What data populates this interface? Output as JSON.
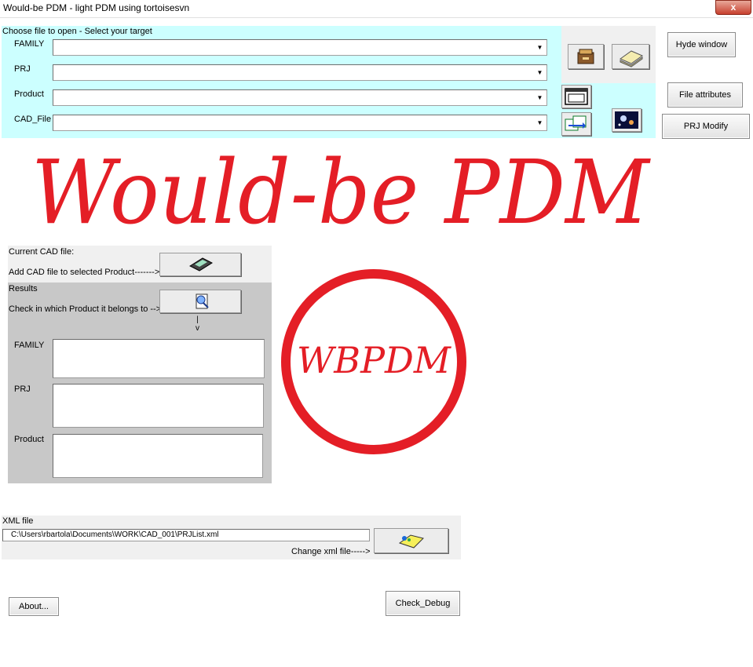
{
  "window": {
    "title": "Would-be PDM - light PDM using tortoisesvn",
    "close_label": "x"
  },
  "target": {
    "header": "Choose file to open - Select your target",
    "fields": [
      {
        "label": "FAMILY",
        "value": ""
      },
      {
        "label": "PRJ",
        "value": ""
      },
      {
        "label": "Product",
        "value": ""
      },
      {
        "label": "CAD_File",
        "value": ""
      }
    ]
  },
  "right_buttons": {
    "hide": "Hyde window",
    "attributes": "File attributes",
    "prj_modify": "PRJ Modify"
  },
  "logo": {
    "banner": "Would-be PDM",
    "seal": "WBPDM"
  },
  "cad_panel": {
    "current": "Current CAD file:",
    "add": "Add CAD file to selected Product------->",
    "results": "Results",
    "check": "Check in which Product it belongs to -->",
    "arrow": "|\nv",
    "fields": [
      {
        "label": "FAMILY",
        "value": ""
      },
      {
        "label": "PRJ",
        "value": ""
      },
      {
        "label": "Product",
        "value": ""
      }
    ]
  },
  "xml": {
    "label": "XML file",
    "path": "C:\\Users\\rbartola\\Documents\\WORK\\CAD_001\\PRJList.xml",
    "change": "Change xml file----->"
  },
  "bottom": {
    "about": "About...",
    "debug": "Check_Debug"
  },
  "colors": {
    "accent_cyan": "#ccffff",
    "logo_red": "#e41e26"
  }
}
